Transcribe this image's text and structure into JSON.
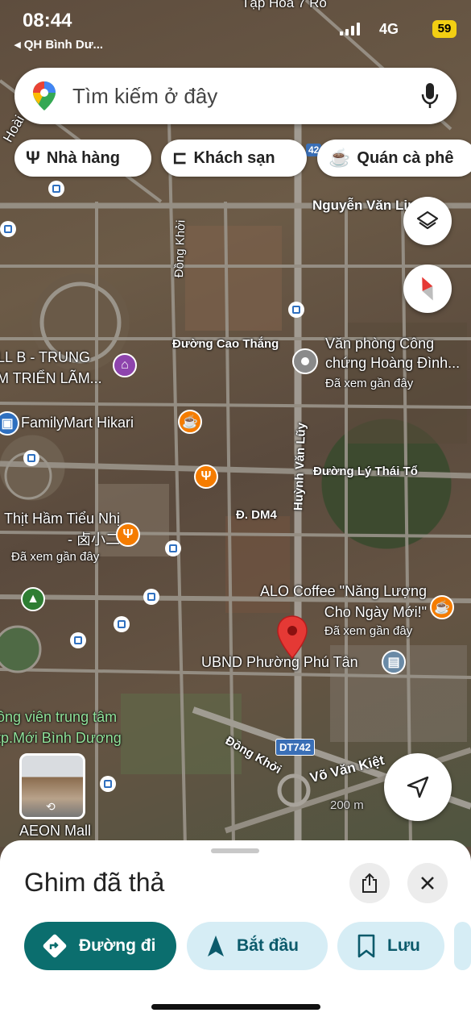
{
  "status_bar": {
    "time": "08:44",
    "back_label": "◂ QH Bình Dư...",
    "network": "4G",
    "battery": "59"
  },
  "search": {
    "placeholder": "Tìm kiếm ở đây"
  },
  "chips": [
    {
      "label": "Nhà hàng",
      "icon": "fork-knife-icon"
    },
    {
      "label": "Khách sạn",
      "icon": "bed-icon"
    },
    {
      "label": "Quán cà phê",
      "icon": "coffee-icon"
    }
  ],
  "map": {
    "top_labels": [
      "Tạp Hoá 7 Rô",
      "Nguyễn Văn Lin",
      "Hoài"
    ],
    "streets": [
      "Đồng Khởi",
      "Đường Cao Thắng",
      "Huỳnh Văn Lũy",
      "Đường Lý Thái Tổ",
      "Đ. DM4",
      "Đồng Khởi",
      "Võ Văn Kiệt",
      "DT742"
    ],
    "places": [
      {
        "name": "Văn phòng Công chứng Hoàng Đình...",
        "note": "Đã xem gần đây"
      },
      {
        "name": "LL B - TRUNG M TRIỂN LÃM..."
      },
      {
        "name": "FamilyMart Hikari"
      },
      {
        "name": "Thịt Hầm Tiểu Nhị - 卤小二",
        "note": "Đã xem gần đây"
      },
      {
        "name": "ALO Coffee \"Năng Lượng Cho Ngày Mới!\"",
        "note": "Đã xem gần đây"
      },
      {
        "name": "UBND Phường Phú Tân"
      },
      {
        "name": "ông viên trung tâm tp.Mới Bình Dương"
      },
      {
        "name": "AEON Mall"
      }
    ],
    "scale": "200 m",
    "road_badge": "42"
  },
  "sheet": {
    "title": "Ghim đã thả",
    "actions": [
      {
        "label": "Đường đi",
        "icon": "directions-icon"
      },
      {
        "label": "Bắt đầu",
        "icon": "navigation-arrow-icon"
      },
      {
        "label": "Lưu",
        "icon": "bookmark-icon"
      }
    ]
  },
  "colors": {
    "primary": "#0b6e6e",
    "chip_light": "#d6edf5",
    "pin_red": "#e53935",
    "poi_orange": "#f57c00",
    "battery_yellow": "#f2cf13"
  }
}
